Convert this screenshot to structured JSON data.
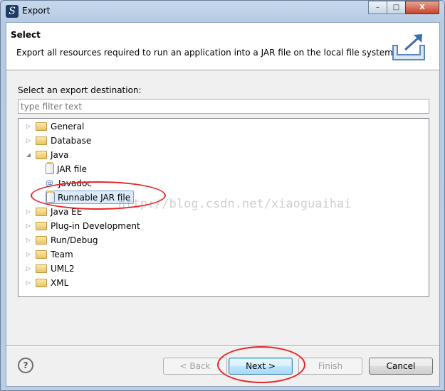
{
  "window": {
    "title": "Export",
    "min": "–",
    "max": "□",
    "close": "X"
  },
  "header": {
    "title": "Select",
    "description": "Export all resources required to run an application into a JAR file on the local file system."
  },
  "destination_label": "Select an export destination:",
  "filter": {
    "value": "",
    "placeholder": "type filter text"
  },
  "tree": [
    {
      "label": "General",
      "type": "folder",
      "expanded": false
    },
    {
      "label": "Database",
      "type": "folder",
      "expanded": false
    },
    {
      "label": "Java",
      "type": "folder",
      "expanded": true
    },
    {
      "label": "JAR file",
      "type": "jar",
      "child": true
    },
    {
      "label": "Javadoc",
      "type": "javadoc",
      "child": true
    },
    {
      "label": "Runnable JAR file",
      "type": "jar",
      "child": true,
      "selected": true
    },
    {
      "label": "Java EE",
      "type": "folder",
      "expanded": false
    },
    {
      "label": "Plug-in Development",
      "type": "folder",
      "expanded": false
    },
    {
      "label": "Run/Debug",
      "type": "folder",
      "expanded": false
    },
    {
      "label": "Team",
      "type": "folder",
      "expanded": false
    },
    {
      "label": "UML2",
      "type": "folder",
      "expanded": false
    },
    {
      "label": "XML",
      "type": "folder",
      "expanded": false
    }
  ],
  "buttons": {
    "help": "?",
    "back": "< Back",
    "next": "Next >",
    "finish": "Finish",
    "cancel": "Cancel"
  },
  "watermark": "http://blog.csdn.net/xiaoguaihai",
  "annotation_color": "#e8262a"
}
